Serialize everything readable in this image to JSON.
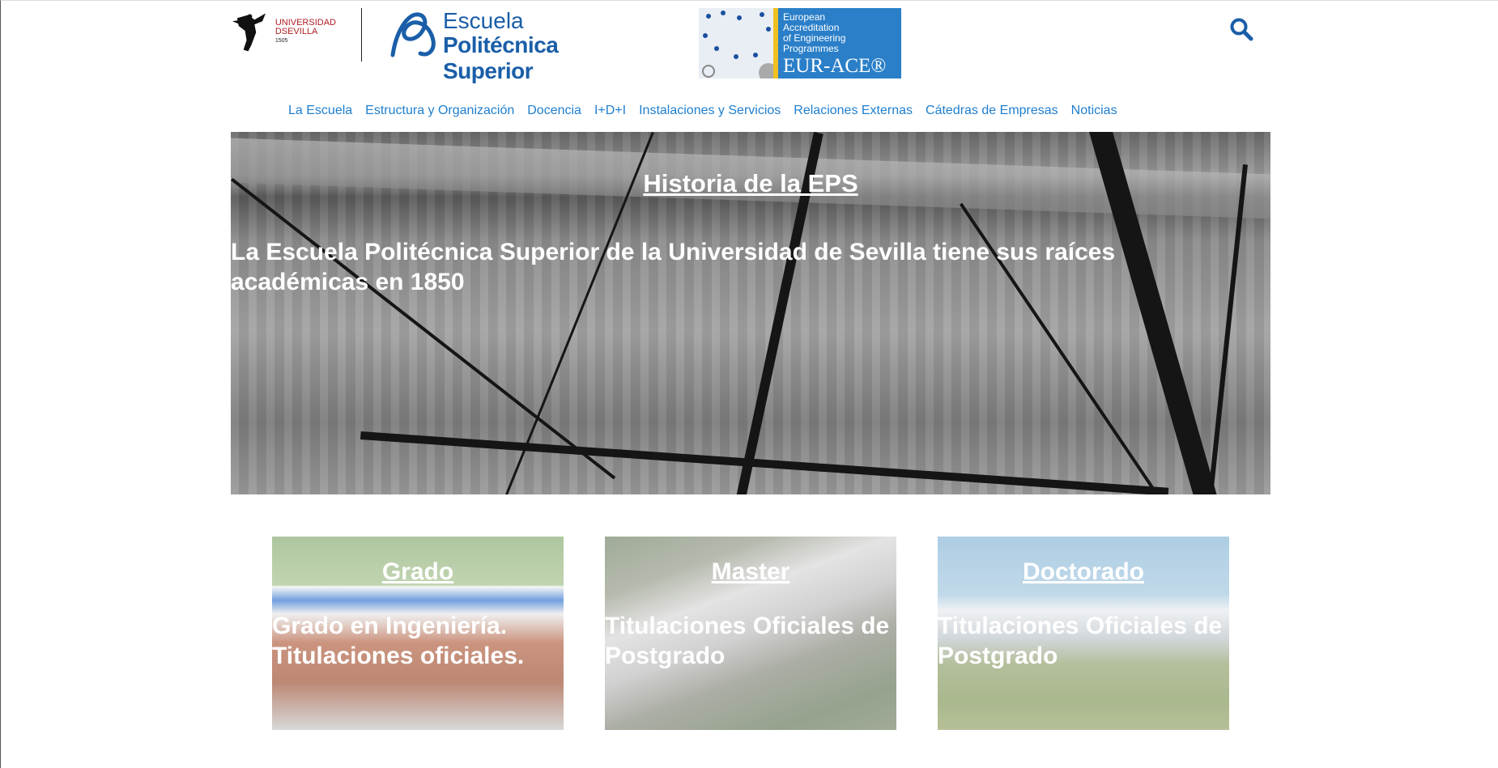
{
  "header": {
    "us_logo": {
      "line1": "UNIVERSIDAD",
      "line2": "DSEVILLA",
      "year": "1505"
    },
    "eps_logo": {
      "line1": "Escuela",
      "line2": "Politécnica Superior"
    },
    "eurace": {
      "line1": "European",
      "line2": "Accreditation",
      "line3": "of Engineering",
      "line4": "Programmes",
      "brand": "EUR-ACE®"
    },
    "search_icon": "search-icon"
  },
  "nav": {
    "items": [
      "La Escuela",
      "Estructura y Organización",
      "Docencia",
      "I+D+I",
      "Instalaciones y Servicios",
      "Relaciones Externas",
      "Cátedras de Empresas",
      "Noticias"
    ]
  },
  "hero": {
    "title": "Historia de la EPS",
    "text": "  La Escuela Politécnica Superior de la Universidad de Sevilla tiene sus raíces académicas en 1850"
  },
  "cards": [
    {
      "title": "Grado",
      "text": " Grado en Ingeniería. Titulaciones oficiales."
    },
    {
      "title": "Master",
      "text": " Titulaciones Oficiales de Postgrado"
    },
    {
      "title": "Doctorado",
      "text": " Titulaciones Oficiales de Postgrado"
    }
  ],
  "colors": {
    "link": "#1f7fcf",
    "brand_blue": "#1a5ea8",
    "us_red": "#b01f24"
  }
}
